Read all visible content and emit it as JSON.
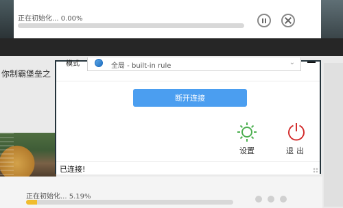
{
  "background": {
    "top_task": {
      "status": "正在初始化... 0.00%",
      "progress": 0.0
    },
    "game_title": "你制霸堡垒之",
    "bottom_task": {
      "status": "正在初始化... 5.19%",
      "progress": 5.19
    }
  },
  "popup": {
    "mode_label": "模式",
    "node_select": {
      "value": "全局 - built-in rule",
      "icon": "globe-icon"
    },
    "disconnect_label": "断开连接",
    "settings_label": "设置",
    "logout_label": "退出",
    "status_text": "已连接!"
  },
  "colors": {
    "accent": "#4b9ef0",
    "settings_icon": "#4caf50",
    "logout_icon": "#d32f2f",
    "progress_fill": "#f0bd2e"
  }
}
